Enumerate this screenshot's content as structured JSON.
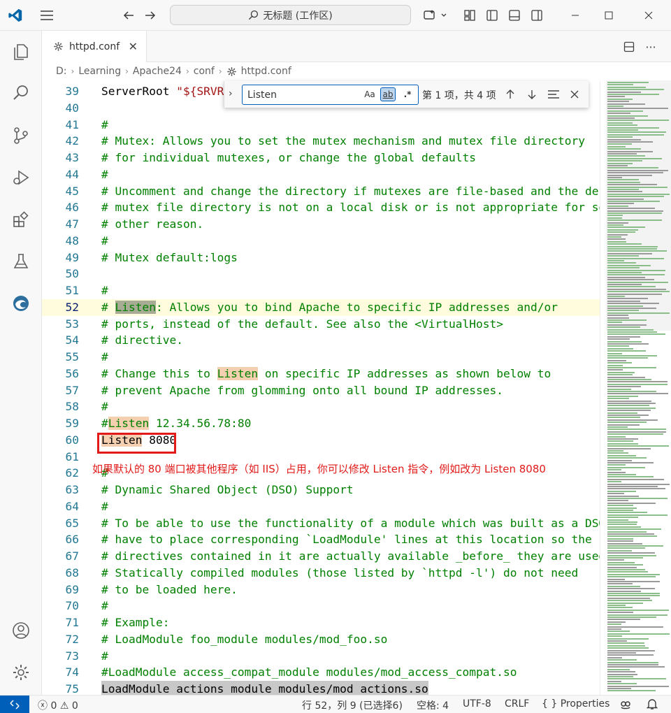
{
  "titlebar": {
    "search_text": "无标题 (工作区)",
    "icons": [
      "vscode-logo-icon",
      "menu-icon",
      "back-arrow-icon",
      "forward-arrow-icon",
      "copilot-icon",
      "layout-icon",
      "toggle-primary-sidebar-icon",
      "toggle-panel-icon",
      "toggle-secondary-sidebar-icon",
      "minimize-icon",
      "maximize-icon",
      "close-icon"
    ]
  },
  "activitybar": {
    "items": [
      "explorer-icon",
      "search-icon",
      "source-control-icon",
      "run-debug-icon",
      "extensions-icon",
      "testing-icon",
      "edge-devtools-icon",
      "accounts-icon",
      "manage-gear-icon"
    ]
  },
  "tab": {
    "label": "httpd.conf",
    "icon": "gear-icon"
  },
  "breadcrumb": {
    "items": [
      "D:",
      "Learning",
      "Apache24",
      "conf",
      "httpd.conf"
    ]
  },
  "find": {
    "query": "Listen",
    "match_case": "Aa",
    "whole_word": "ab",
    "regex": ".*",
    "count": "第 1 项，共 4 项"
  },
  "editor": {
    "lines": [
      {
        "n": "39",
        "text": "ServerRoot \"${SRVROOT}\""
      },
      {
        "n": "40",
        "text": ""
      },
      {
        "n": "41",
        "text": "#"
      },
      {
        "n": "42",
        "text": "# Mutex: Allows you to set the mutex mechanism and mutex file directory"
      },
      {
        "n": "43",
        "text": "# for individual mutexes, or change the global defaults"
      },
      {
        "n": "44",
        "text": "#"
      },
      {
        "n": "45",
        "text": "# Uncomment and change the directory if mutexes are file-based and the default"
      },
      {
        "n": "46",
        "text": "# mutex file directory is not on a local disk or is not appropriate for some"
      },
      {
        "n": "47",
        "text": "# other reason."
      },
      {
        "n": "48",
        "text": "#"
      },
      {
        "n": "49",
        "text": "# Mutex default:logs"
      },
      {
        "n": "50",
        "text": ""
      },
      {
        "n": "51",
        "text": "#"
      },
      {
        "n": "52",
        "text": "# Listen: Allows you to bind Apache to specific IP addresses and/or"
      },
      {
        "n": "53",
        "text": "# ports, instead of the default. See also the <VirtualHost>"
      },
      {
        "n": "54",
        "text": "# directive."
      },
      {
        "n": "55",
        "text": "#"
      },
      {
        "n": "56",
        "text": "# Change this to Listen on specific IP addresses as shown below to"
      },
      {
        "n": "57",
        "text": "# prevent Apache from glomming onto all bound IP addresses."
      },
      {
        "n": "58",
        "text": "#"
      },
      {
        "n": "59",
        "text": "#Listen 12.34.56.78:80"
      },
      {
        "n": "60",
        "text": "Listen 8080"
      },
      {
        "n": "61",
        "text": ""
      },
      {
        "n": "62",
        "text": "#"
      },
      {
        "n": "63",
        "text": "# Dynamic Shared Object (DSO) Support"
      },
      {
        "n": "64",
        "text": "#"
      },
      {
        "n": "65",
        "text": "# To be able to use the functionality of a module which was built as a DSO you"
      },
      {
        "n": "66",
        "text": "# have to place corresponding `LoadModule' lines at this location so the"
      },
      {
        "n": "67",
        "text": "# directives contained in it are actually available _before_ they are used."
      },
      {
        "n": "68",
        "text": "# Statically compiled modules (those listed by `httpd -l') do not need"
      },
      {
        "n": "69",
        "text": "# to be loaded here."
      },
      {
        "n": "70",
        "text": "#"
      },
      {
        "n": "71",
        "text": "# Example:"
      },
      {
        "n": "72",
        "text": "# LoadModule foo_module modules/mod_foo.so"
      },
      {
        "n": "73",
        "text": "#"
      },
      {
        "n": "74",
        "text": "#LoadModule access_compat_module modules/mod_access_compat.so"
      },
      {
        "n": "75",
        "text": "LoadModule actions_module modules/mod_actions.so"
      }
    ]
  },
  "annotation": "如果默认的 80 端口被其他程序（如 IIS）占用，你可以修改 Listen 指令，例如改为 Listen 8080",
  "statusbar": {
    "errors": "0",
    "warnings": "0",
    "position": "行 52，列 9 (已选择6)",
    "spaces": "空格: 4",
    "encoding": "UTF-8",
    "eol": "CRLF",
    "language": "{ } Properties"
  },
  "colors": {
    "accent": "#005fb8",
    "comment": "#008000",
    "annotation_red": "#e21a1a",
    "match_highlight": "#f5d0b0"
  }
}
